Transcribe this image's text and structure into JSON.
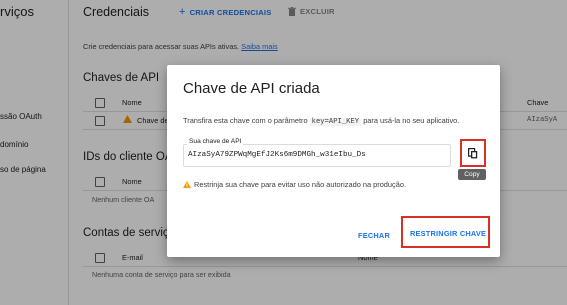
{
  "sidebar": {
    "title": "rviços",
    "items": [
      {
        "label": "ssão OAuth"
      },
      {
        "label": "domínio"
      },
      {
        "label": "so de página"
      }
    ]
  },
  "toolbar": {
    "title": "Credenciais",
    "create_label": "CRIAR CREDENCIAIS",
    "delete_label": "EXCLUIR"
  },
  "description": {
    "text": "Crie credenciais para acessar suas APIs ativas.",
    "link": "Saiba mais"
  },
  "api_keys": {
    "heading": "Chaves de API",
    "columns": {
      "name": "Nome",
      "key": "Chave"
    },
    "row": {
      "name": "Chave de",
      "key": "AIzaSyA"
    }
  },
  "oauth_clients": {
    "heading": "IDs do cliente OA",
    "columns": {
      "name": "Nome"
    },
    "empty": "Nenhum cliente OA"
  },
  "service_accounts": {
    "heading": "Contas de serviço",
    "columns": {
      "email": "E-mail",
      "name": "Nome"
    },
    "empty": "Nenhuma conta de serviço para ser exibida"
  },
  "dialog": {
    "title": "Chave de API criada",
    "subtitle_before": "Transfira esta chave com o parâmetro",
    "subtitle_code": "key=API_KEY",
    "subtitle_after": "para usá-la no seu aplicativo.",
    "key_label": "Sua chave de API",
    "key_value": "AIzaSyA79ZPWqMgEfJ2Ks6m9DMGh_w31eIbu_Ds",
    "copy_tooltip": "Copy",
    "warning": "Restrinja sua chave para evitar uso não autorizado na produção.",
    "close_label": "FECHAR",
    "restrict_label": "RESTRINGIR CHAVE"
  },
  "colors": {
    "accent": "#1a73e8",
    "highlight": "#d93025",
    "warning": "#f29900"
  }
}
